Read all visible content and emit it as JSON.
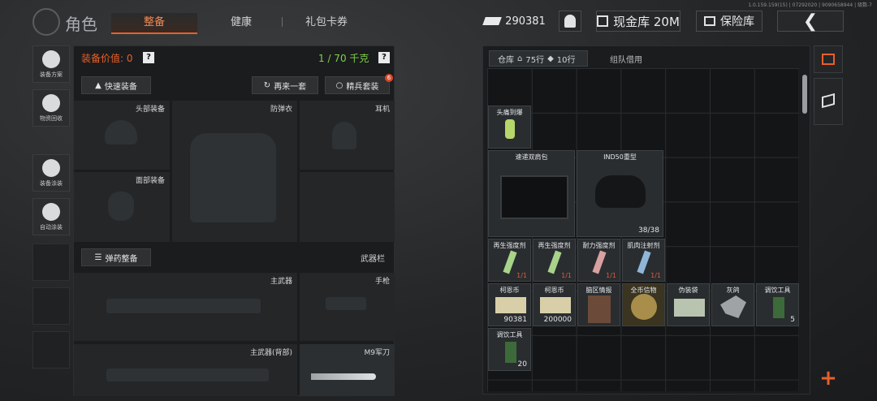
{
  "header": {
    "title": "角色",
    "version": "1.0.159.159(15) | 07292020 | 9090658944 | 级数-7",
    "tabs": [
      {
        "label": "整备",
        "active": true
      },
      {
        "label": "健康",
        "active": false
      },
      {
        "label": "礼包卡券",
        "active": false
      }
    ],
    "currency": "290381",
    "cash_vault_label": "现金库 20M",
    "safe_box_label": "保险库",
    "back_icon": "chevron-left-icon"
  },
  "left_rail": [
    {
      "label": "装备方案",
      "icon": "loadout-icon"
    },
    {
      "label": "物资回收",
      "icon": "recycle-icon"
    },
    {
      "label": "装备涂装",
      "icon": "helmet-paint-icon"
    },
    {
      "label": "自动涂装",
      "icon": "auto-paint-icon"
    }
  ],
  "equipment": {
    "value_label": "装备价值:",
    "value": "0",
    "weight": "1 / 70 千克",
    "quick_equip": "快速装备",
    "again": "再来一套",
    "elite": "精兵套装",
    "elite_badge": "6",
    "slots": {
      "head": "头部装备",
      "armor": "防弹衣",
      "headset": "耳机",
      "face": "面部装备",
      "ammo_btn": "弹药整备",
      "weapon_bar": "武器栏",
      "primary": "主武器",
      "pistol": "手枪",
      "primary_back": "主武器(背部)",
      "knife": "M9军刀"
    }
  },
  "storage": {
    "tab_label": "仓库",
    "rows": "75行",
    "rows_extra": "10行",
    "team_tab": "组队借用",
    "items": {
      "i1": {
        "name": "头痛到爆"
      },
      "i2": {
        "name": "速递双肩包"
      },
      "i3": {
        "name": "IND50重型",
        "count": "38/38"
      },
      "i4": {
        "name": "再生强度剂",
        "dur": "1/1"
      },
      "i5": {
        "name": "再生强度剂",
        "dur": "1/1"
      },
      "i6": {
        "name": "耐力强度剂",
        "dur": "1/1"
      },
      "i7": {
        "name": "肌肉注射剂",
        "dur": "1/1"
      },
      "i8": {
        "name": "柯恩币",
        "count": "90381"
      },
      "i9": {
        "name": "柯恩币",
        "count": "200000"
      },
      "i10": {
        "name": "脑区情报"
      },
      "i11": {
        "name": "全币信物"
      },
      "i12": {
        "name": "伪装袋"
      },
      "i13": {
        "name": "灰鸽"
      },
      "i14": {
        "name": "调饮工具",
        "count": "5"
      },
      "i15": {
        "name": "调饮工具",
        "count": "20"
      }
    }
  },
  "colors": {
    "accent": "#e8602a",
    "green": "#7fd14a",
    "duration_red": "#e05a3a"
  }
}
